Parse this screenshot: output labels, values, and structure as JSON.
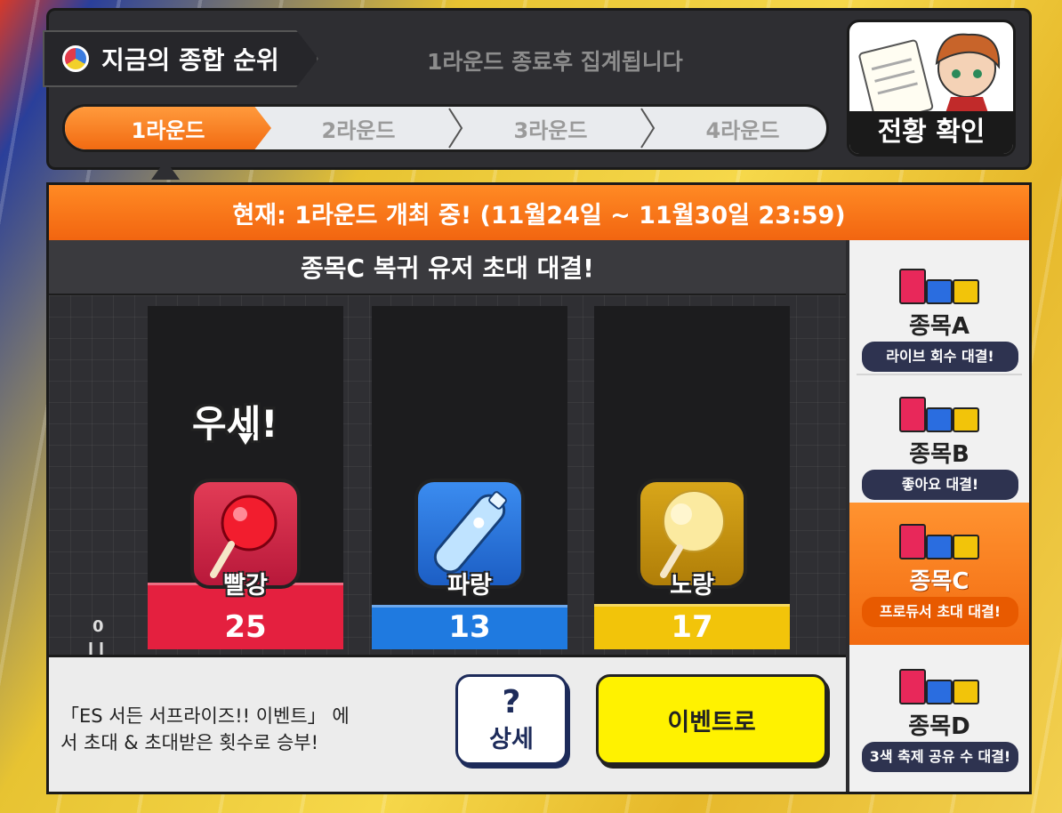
{
  "header": {
    "title": "지금의 종합 순위",
    "aggregation_note": "1라운드 종료후 집계됩니다",
    "rounds": [
      "1라운드",
      "2라운드",
      "3라운드",
      "4라운드"
    ],
    "active_round_index": 0,
    "status_button_label": "전황 확인"
  },
  "banner": {
    "current": "현재: 1라운드 개최 중!  (11월24일 ~ 11월30일 23:59)"
  },
  "event": {
    "title": "종목C   복귀 유저 초대 대결!",
    "leading_label": "우세!"
  },
  "teams": [
    {
      "name": "빨강",
      "score": "25",
      "icon": "candy-apple-icon",
      "color": "#e4203f",
      "level": 0.25
    },
    {
      "name": "파랑",
      "score": "13",
      "icon": "ramune-bottle-icon",
      "color": "#1f7ae0",
      "level": 0.13
    },
    {
      "name": "노랑",
      "score": "17",
      "icon": "cotton-candy-icon",
      "color": "#f2c40a",
      "level": 0.17
    }
  ],
  "axis_zero": "0",
  "bottom": {
    "description": "「ES 서든 서프라이즈!! 이벤트」 에\n서 초대 & 초대받은 횟수로 승부!",
    "detail_icon": "?",
    "detail_label": "상세",
    "event_button_label": "이벤트로"
  },
  "categories": [
    {
      "name": "종목A",
      "subtitle": "라이브 회수 대결!",
      "active": false
    },
    {
      "name": "종목B",
      "subtitle": "좋아요 대결!",
      "active": false
    },
    {
      "name": "종목C",
      "subtitle": "프로듀서 초대 대결!",
      "active": true
    },
    {
      "name": "종목D",
      "subtitle": "3색 축제 공유 수 대결!",
      "active": false
    }
  ]
}
